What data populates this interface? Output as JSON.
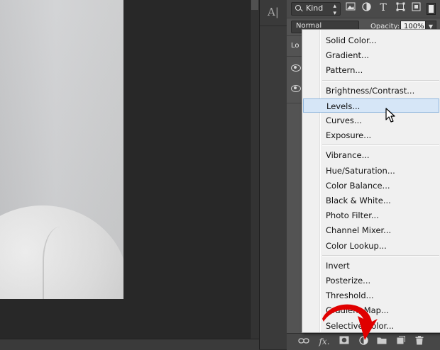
{
  "layers_panel": {
    "filter": {
      "kind_label": "Kind"
    },
    "filter_icons": [
      "image-filter-icon",
      "adjustment-filter-icon",
      "type-filter-icon",
      "shape-filter-icon",
      "smart-object-filter-icon"
    ],
    "type_glyph": "T",
    "blend_mode": "Normal",
    "opacity_label": "Opacity:",
    "opacity_value": "100%",
    "lock_label_partial": "Lo",
    "bottom_icons": [
      "link-icon",
      "fx-icon",
      "mask-icon",
      "adjustment-layer-icon",
      "group-folder-icon",
      "new-layer-icon",
      "trash-icon"
    ],
    "fx_label": "fx."
  },
  "adjustment_menu": {
    "groups": [
      [
        "Solid Color...",
        "Gradient...",
        "Pattern..."
      ],
      [
        "Brightness/Contrast...",
        "Levels...",
        "Curves...",
        "Exposure..."
      ],
      [
        "Vibrance...",
        "Hue/Saturation...",
        "Color Balance...",
        "Black & White...",
        "Photo Filter...",
        "Channel Mixer...",
        "Color Lookup..."
      ],
      [
        "Invert",
        "Posterize...",
        "Threshold...",
        "Gradient Map...",
        "Selective Color..."
      ]
    ],
    "highlighted": "Levels..."
  },
  "tool_strip": {
    "text_tool_glyph": "A|"
  },
  "colors": {
    "menu_bg": "#f0f0f0",
    "highlight": "#d6e6f7",
    "annotation_arrow": "#e00000",
    "panel_bg": "#535353"
  }
}
